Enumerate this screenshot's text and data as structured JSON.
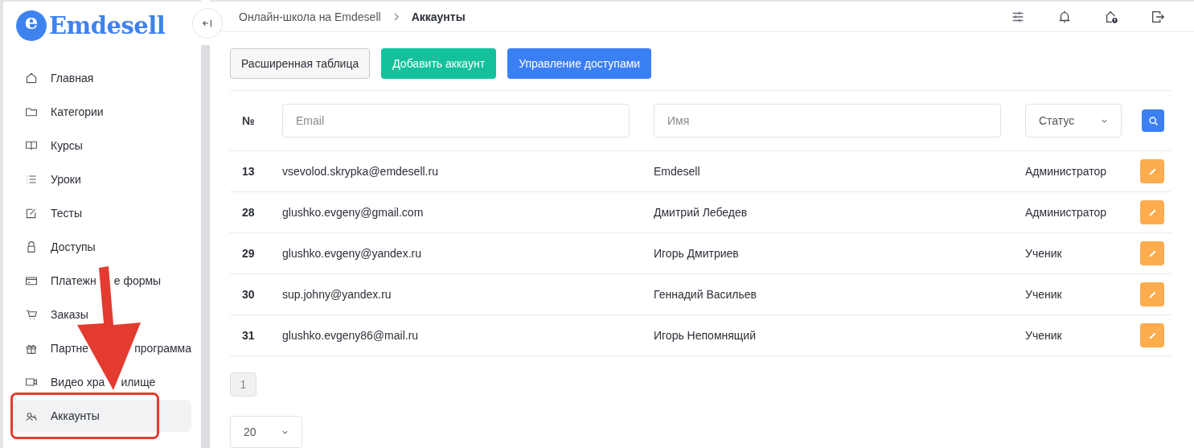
{
  "logo": {
    "mark": "e",
    "name": "Emdesell"
  },
  "breadcrumbs": [
    {
      "label": "Онлайн-школа на Emdesell",
      "current": false
    },
    {
      "label": "Аккаунты",
      "current": true
    }
  ],
  "sidebar": {
    "items": [
      {
        "label": "Главная",
        "selected": false
      },
      {
        "label": "Категории",
        "selected": false
      },
      {
        "label": "Курсы",
        "selected": false
      },
      {
        "label": "Уроки",
        "selected": false
      },
      {
        "label": "Тесты",
        "selected": false
      },
      {
        "label": "Доступы",
        "selected": false
      },
      {
        "label_parts": [
          "Платежн",
          "е формы"
        ],
        "selected": false
      },
      {
        "label": "Заказы",
        "selected": false
      },
      {
        "label_parts": [
          "Партне",
          "программа"
        ],
        "selected": false
      },
      {
        "label_parts": [
          "Видео хра",
          "илище"
        ],
        "selected": false
      },
      {
        "label": "Аккаунты",
        "selected": true
      }
    ]
  },
  "toolbar": [
    {
      "label": "Расширенная таблица",
      "kind": "outline"
    },
    {
      "label": "Добавить аккаунт",
      "kind": "green"
    },
    {
      "label": "Управление доступами",
      "kind": "blue"
    }
  ],
  "table": {
    "columns": [
      {
        "label": "№",
        "kind": "label"
      },
      {
        "placeholder": "Email",
        "kind": "input"
      },
      {
        "placeholder": "Имя",
        "kind": "input"
      },
      {
        "label": "Статус",
        "kind": "select"
      }
    ],
    "rows": [
      {
        "id": "13",
        "email": "vsevolod.skrypka@emdesell.ru",
        "name": "Emdesell",
        "status": "Администратор"
      },
      {
        "id": "28",
        "email": "glushko.evgeny@gmail.com",
        "name": "Дмитрий Лебедев",
        "status": "Администратор"
      },
      {
        "id": "29",
        "email": "glushko.evgeny@yandex.ru",
        "name": "Игорь Дмитриев",
        "status": "Ученик"
      },
      {
        "id": "30",
        "email": "sup.johny@yandex.ru",
        "name": "Геннадий Васильев",
        "status": "Ученик"
      },
      {
        "id": "31",
        "email": "glushko.evgeny86@mail.ru",
        "name": "Игорь Непомнящий",
        "status": "Ученик"
      }
    ]
  },
  "pagination": {
    "pages": [
      {
        "label": "1",
        "selected": true
      }
    ],
    "page_size": "20"
  }
}
